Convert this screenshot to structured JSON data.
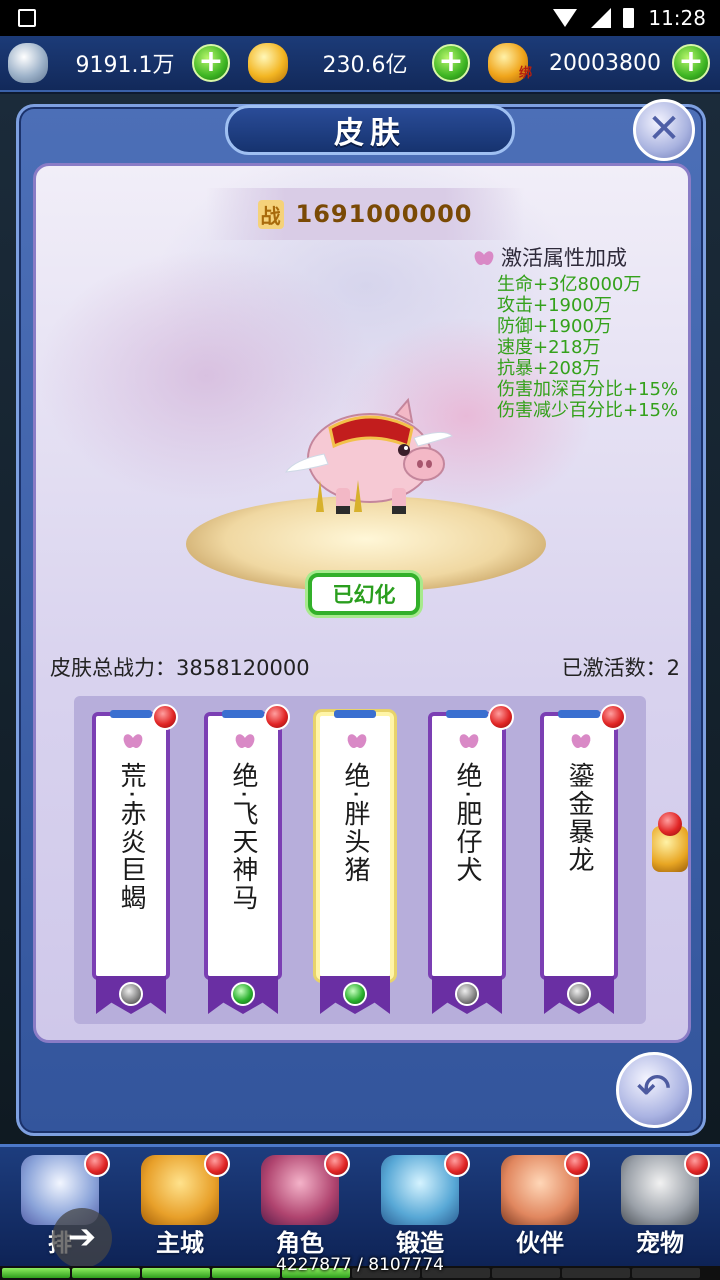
{
  "status_bar": {
    "time": "11:28"
  },
  "currencies": [
    {
      "name": "silver",
      "value": "9191.1万"
    },
    {
      "name": "gold",
      "value": "230.6亿"
    },
    {
      "name": "bound-gold",
      "tag": "绑",
      "value": "20003800"
    }
  ],
  "panel": {
    "title": "皮肤",
    "close_symbol": "✕",
    "battle_power_label": "战",
    "battle_power": "1691000000",
    "attr_title": "激活属性加成",
    "attributes": [
      "生命+3亿8000万",
      "攻击+1900万",
      "防御+1900万",
      "速度+218万",
      "抗暴+208万",
      "伤害加深百分比+15%",
      "伤害减少百分比+15%"
    ],
    "status_badge": "已幻化",
    "total_power_label": "皮肤总战力：3858120000",
    "activated_label": "已激活数：2",
    "back_symbol": "↶"
  },
  "skins": [
    {
      "name": "荒·赤炎巨蝎",
      "gem": "grey"
    },
    {
      "name": "绝·飞天神马",
      "gem": "green"
    },
    {
      "name": "绝·胖头猪",
      "gem": "green"
    },
    {
      "name": "绝·肥仔犬",
      "gem": "grey"
    },
    {
      "name": "鎏金暴龙",
      "gem": "grey"
    }
  ],
  "nav": [
    {
      "label": "排"
    },
    {
      "label": "主城"
    },
    {
      "label": "角色"
    },
    {
      "label": "锻造"
    },
    {
      "label": "伙伴"
    },
    {
      "label": "宠物"
    }
  ],
  "float_button": "➔",
  "exp": {
    "text": "4227877 / 8107774",
    "fraction": 0.52
  }
}
